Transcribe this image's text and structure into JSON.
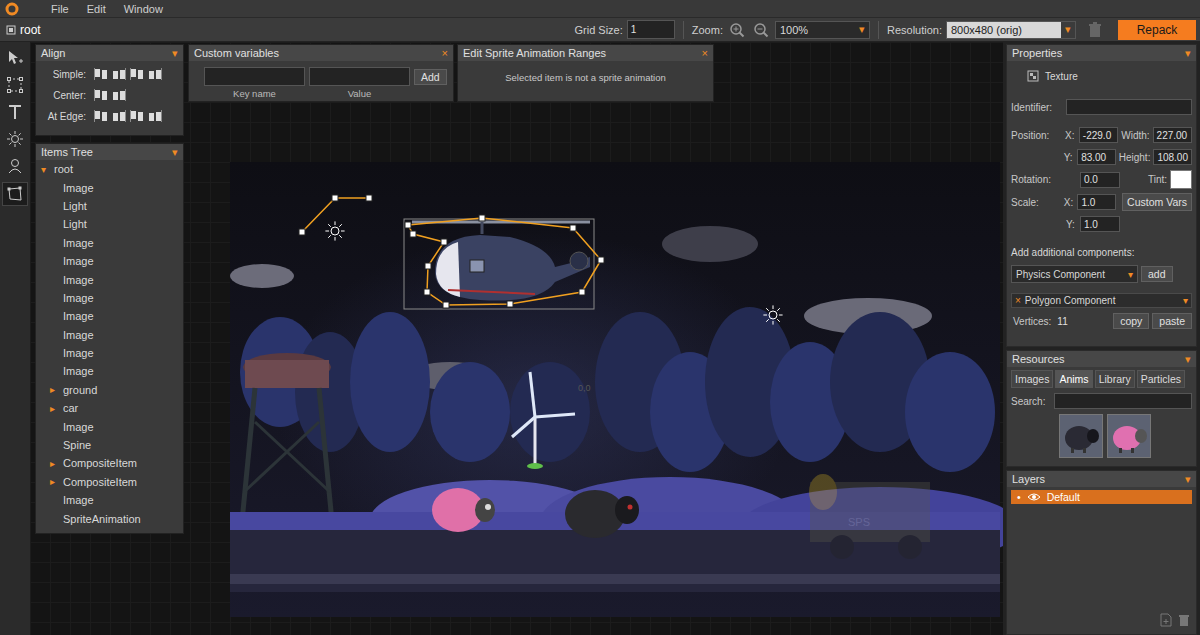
{
  "menu": [
    "File",
    "Edit",
    "Window"
  ],
  "toolbar": {
    "breadcrumb": "root",
    "grid_label": "Grid Size:",
    "grid_value": "1",
    "zoom_label": "Zoom:",
    "zoom_value": "100%",
    "dropdown_icon": "▾",
    "resolution_label": "Resolution:",
    "resolution_value": "800x480 (orig)",
    "repack": "Repack"
  },
  "tools": [
    {
      "kind": "select",
      "selected": false
    },
    {
      "kind": "transform",
      "selected": false
    },
    {
      "kind": "text",
      "selected": false
    },
    {
      "kind": "light",
      "selected": false
    },
    {
      "kind": "person",
      "selected": false
    },
    {
      "kind": "polygon",
      "selected": true
    }
  ],
  "align": {
    "title": "Align",
    "toggle": "▾",
    "rows": [
      {
        "label": "Simple:",
        "icons": 4
      },
      {
        "label": "Center:",
        "icons": 2
      },
      {
        "label": "At Edge:",
        "icons": 4
      }
    ]
  },
  "custom_variables": {
    "title": "Custom variables",
    "close": "×",
    "key_value": "",
    "value_value": "",
    "add": "Add",
    "key_label": "Key name",
    "value_label": "Value"
  },
  "sprite_ranges": {
    "title": "Edit Sprite Animation Ranges",
    "close": "×",
    "message": "Selected item is not a sprite animation"
  },
  "items_tree": {
    "title": "Items Tree",
    "toggle": "▾",
    "expand_icons": {
      "expanded": "▾",
      "collapsed": "▸"
    },
    "root": {
      "label": "root",
      "expanded": true
    },
    "items": [
      {
        "label": "Image",
        "expandable": false,
        "expanded": false
      },
      {
        "label": "Light",
        "expandable": false,
        "expanded": false
      },
      {
        "label": "Light",
        "expandable": false,
        "expanded": false
      },
      {
        "label": "Image",
        "expandable": false,
        "expanded": false
      },
      {
        "label": "Image",
        "expandable": false,
        "expanded": false
      },
      {
        "label": "Image",
        "expandable": false,
        "expanded": false
      },
      {
        "label": "Image",
        "expandable": false,
        "expanded": false
      },
      {
        "label": "Image",
        "expandable": false,
        "expanded": false
      },
      {
        "label": "Image",
        "expandable": false,
        "expanded": false
      },
      {
        "label": "Image",
        "expandable": false,
        "expanded": false
      },
      {
        "label": "Image",
        "expandable": false,
        "expanded": false
      },
      {
        "label": "ground",
        "expandable": true,
        "expanded": false
      },
      {
        "label": "car",
        "expandable": true,
        "expanded": false
      },
      {
        "label": "Image",
        "expandable": false,
        "expanded": false
      },
      {
        "label": "Spine",
        "expandable": false,
        "expanded": false
      },
      {
        "label": "CompositeItem",
        "expandable": true,
        "expanded": false
      },
      {
        "label": "CompositeItem",
        "expandable": true,
        "expanded": false
      },
      {
        "label": "Image",
        "expandable": false,
        "expanded": false
      },
      {
        "label": "SpriteAnimation",
        "expandable": false,
        "expanded": false
      }
    ]
  },
  "scene": {
    "origin_label": "0,0",
    "truck_label": "SPS"
  },
  "properties": {
    "title": "Properties",
    "toggle": "▾",
    "type": "Texture",
    "identifier_label": "Identifier:",
    "identifier_value": "",
    "position_label": "Position:",
    "x_label": "X:",
    "x_value": "-229.0",
    "y_label": "Y:",
    "y_value": "83.00",
    "width_label": "Width:",
    "width_value": "227.00",
    "height_label": "Height:",
    "height_value": "108.00",
    "rotation_label": "Rotation:",
    "rotation_value": "0.0",
    "tint_label": "Tint:",
    "tint_color": "#ffffff",
    "scale_label": "Scale:",
    "scale_x": "1.0",
    "scale_y": "1.0",
    "custom_vars": "Custom Vars",
    "add_components_label": "Add additional components:",
    "component_choice": "Physics Component",
    "add_button": "add",
    "component": {
      "remove": "×",
      "name": "Polygon Component",
      "toggle": "▾",
      "vertices_label": "Vertices:",
      "vertices_value": "11",
      "copy": "copy",
      "paste": "paste"
    }
  },
  "resources": {
    "title": "Resources",
    "toggle": "▾",
    "tabs": [
      {
        "label": "Images",
        "selected": false
      },
      {
        "label": "Anims",
        "selected": true
      },
      {
        "label": "Library",
        "selected": false
      },
      {
        "label": "Particles",
        "selected": false
      }
    ],
    "search_label": "Search:",
    "search_value": "",
    "thumbnails": [
      {
        "kind": "black"
      },
      {
        "kind": "pink"
      }
    ]
  },
  "layers": {
    "title": "Layers",
    "toggle": "▾",
    "items": [
      {
        "name": "Default",
        "selected": true,
        "visible": true,
        "bullet": "•"
      }
    ]
  }
}
